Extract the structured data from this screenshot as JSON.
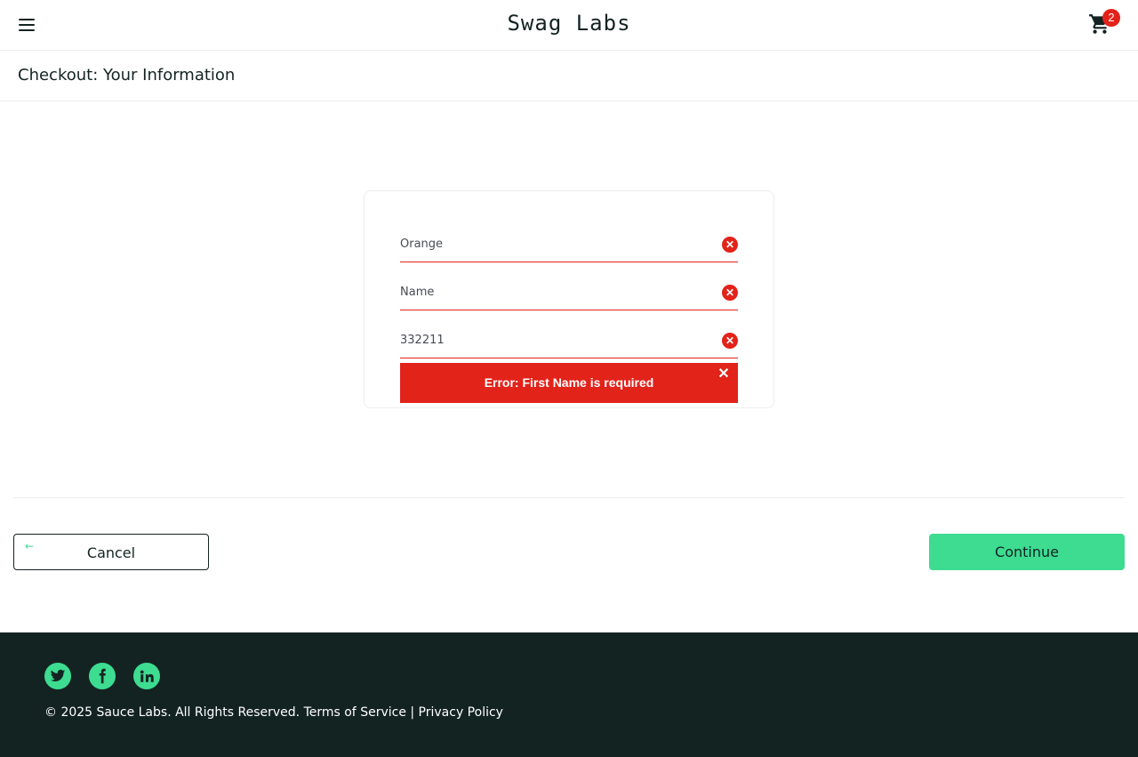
{
  "header": {
    "logo": "Swag Labs",
    "menu_icon": "hamburger-menu-icon",
    "cart_icon": "shopping-cart-icon",
    "cart_count": "2"
  },
  "subheader": {
    "title": "Checkout: Your Information"
  },
  "form": {
    "first_name": "Orange",
    "last_name": "Name",
    "postal_code": "332211",
    "error_icon": "error-x-circle-icon",
    "error_message": "Error: First Name is required",
    "error_close": "✕"
  },
  "actions": {
    "cancel_label": "Cancel",
    "cancel_icon": "arrow-left-icon",
    "continue_label": "Continue"
  },
  "footer": {
    "social": [
      "twitter-icon",
      "facebook-icon",
      "linkedin-icon"
    ],
    "copyright": "© 2025 Sauce Labs. All Rights Reserved. Terms of Service | Privacy Policy"
  },
  "colors": {
    "brand_green": "#3ddc91",
    "error_red": "#e2231a",
    "dark": "#132322"
  }
}
